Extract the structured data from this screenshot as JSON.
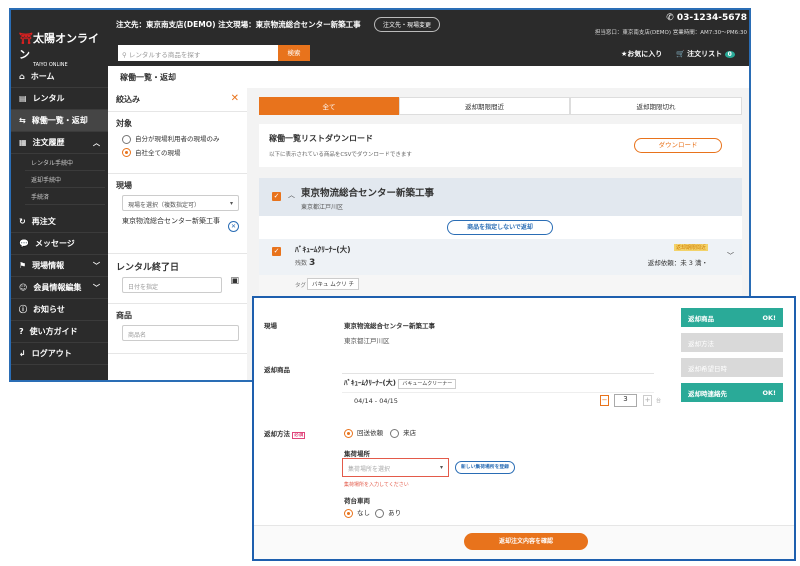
{
  "header": {
    "logo": "太陽オンライン",
    "logo_sub": "TAIYO ONLINE",
    "order_info": "注文先：東京南支店(DEMO) 注文現場：東京物流総合センター新築工事",
    "change_button": "注文先・現場変更",
    "phone": "03-1234-5678",
    "contact": "担当窓口：東京南支店(DEMO) 営業時間：AM7:30〜PM6:30",
    "search_placeholder": "レンタルする商品を探す",
    "search_button": "検索",
    "favorites": "お気に入り",
    "order_list": "注文リスト",
    "cart_count": "0"
  },
  "sidebar": {
    "items": [
      {
        "label": "ホーム"
      },
      {
        "label": "レンタル"
      },
      {
        "label": "稼働一覧・返却"
      },
      {
        "label": "注文履歴"
      },
      {
        "label": "再注文"
      },
      {
        "label": "メッセージ"
      },
      {
        "label": "現場情報"
      },
      {
        "label": "会員情報編集"
      },
      {
        "label": "お知らせ"
      },
      {
        "label": "使い方ガイド"
      },
      {
        "label": "ログアウト"
      }
    ],
    "sub_items": [
      "レンタル手続中",
      "返却手続中",
      "手続済"
    ]
  },
  "breadcrumb": "稼働一覧・返却",
  "filter": {
    "title": "絞込み",
    "target_label": "対象",
    "target_options": [
      "自分が現場利用者の現場のみ",
      "自社全ての現場"
    ],
    "site_label": "現場",
    "site_select": "現場を選択（複数指定可）",
    "site_selected": "東京物流総合センター新築工事",
    "end_date_label": "レンタル終了日",
    "date_placeholder": "日付を指定",
    "product_label": "商品",
    "product_placeholder": "商品名"
  },
  "tabs": [
    "全て",
    "返却期限間近",
    "返却期限切れ"
  ],
  "download": {
    "title": "稼働一覧リストダウンロード",
    "desc": "以下に表示されている商品をCSVでダウンロードできます",
    "button": "ダウンロード"
  },
  "site_group": {
    "name": "東京物流総合センター新築工事",
    "address": "東京都江戸川区",
    "return_all_button": "商品を指定しないで返却"
  },
  "item": {
    "name": "ﾊﾞｷｭｰﾑｸﾘｰﾅｰ(大)",
    "qty_label": "残数",
    "qty": "3",
    "badge": "返却期限間近",
    "return_info": "返却依頼：未 3 満・",
    "tag_label": "タグ",
    "tag": "バキュ ムクリ チ"
  },
  "overlay": {
    "site_label": "現場",
    "site_name": "東京物流総合センター新築工事",
    "site_address": "東京都江戸川区",
    "return_items_label": "返却商品",
    "item_name": "ﾊﾞｷｭｰﾑｸﾘｰﾅｰ(大)",
    "item_tag": "バキュームクリーナー",
    "period": "04/14 - 04/15",
    "qty": "3",
    "qty_unit": "台",
    "method_label": "返却方法",
    "required": "必須",
    "method_options": [
      "回送依頼",
      "来店"
    ],
    "pickup_label": "集荷場所",
    "pickup_placeholder": "集荷場所を選択",
    "new_pickup_button": "新しい集荷場所を登録",
    "pickup_error": "集荷場所を入力してください",
    "vehicle_label": "荷台車両",
    "vehicle_options": [
      "なし",
      "あり"
    ],
    "confirm_button": "返却注文内容を確認",
    "steps": [
      {
        "label": "返却商品",
        "status": "OK!"
      },
      {
        "label": "返却方法",
        "status": ""
      },
      {
        "label": "返却希望日時",
        "status": ""
      },
      {
        "label": "返却時連絡先",
        "status": "OK!"
      }
    ]
  },
  "colors": {
    "accent": "#e8731c",
    "teal": "#2aaa98",
    "frame": "#2a6db5"
  }
}
